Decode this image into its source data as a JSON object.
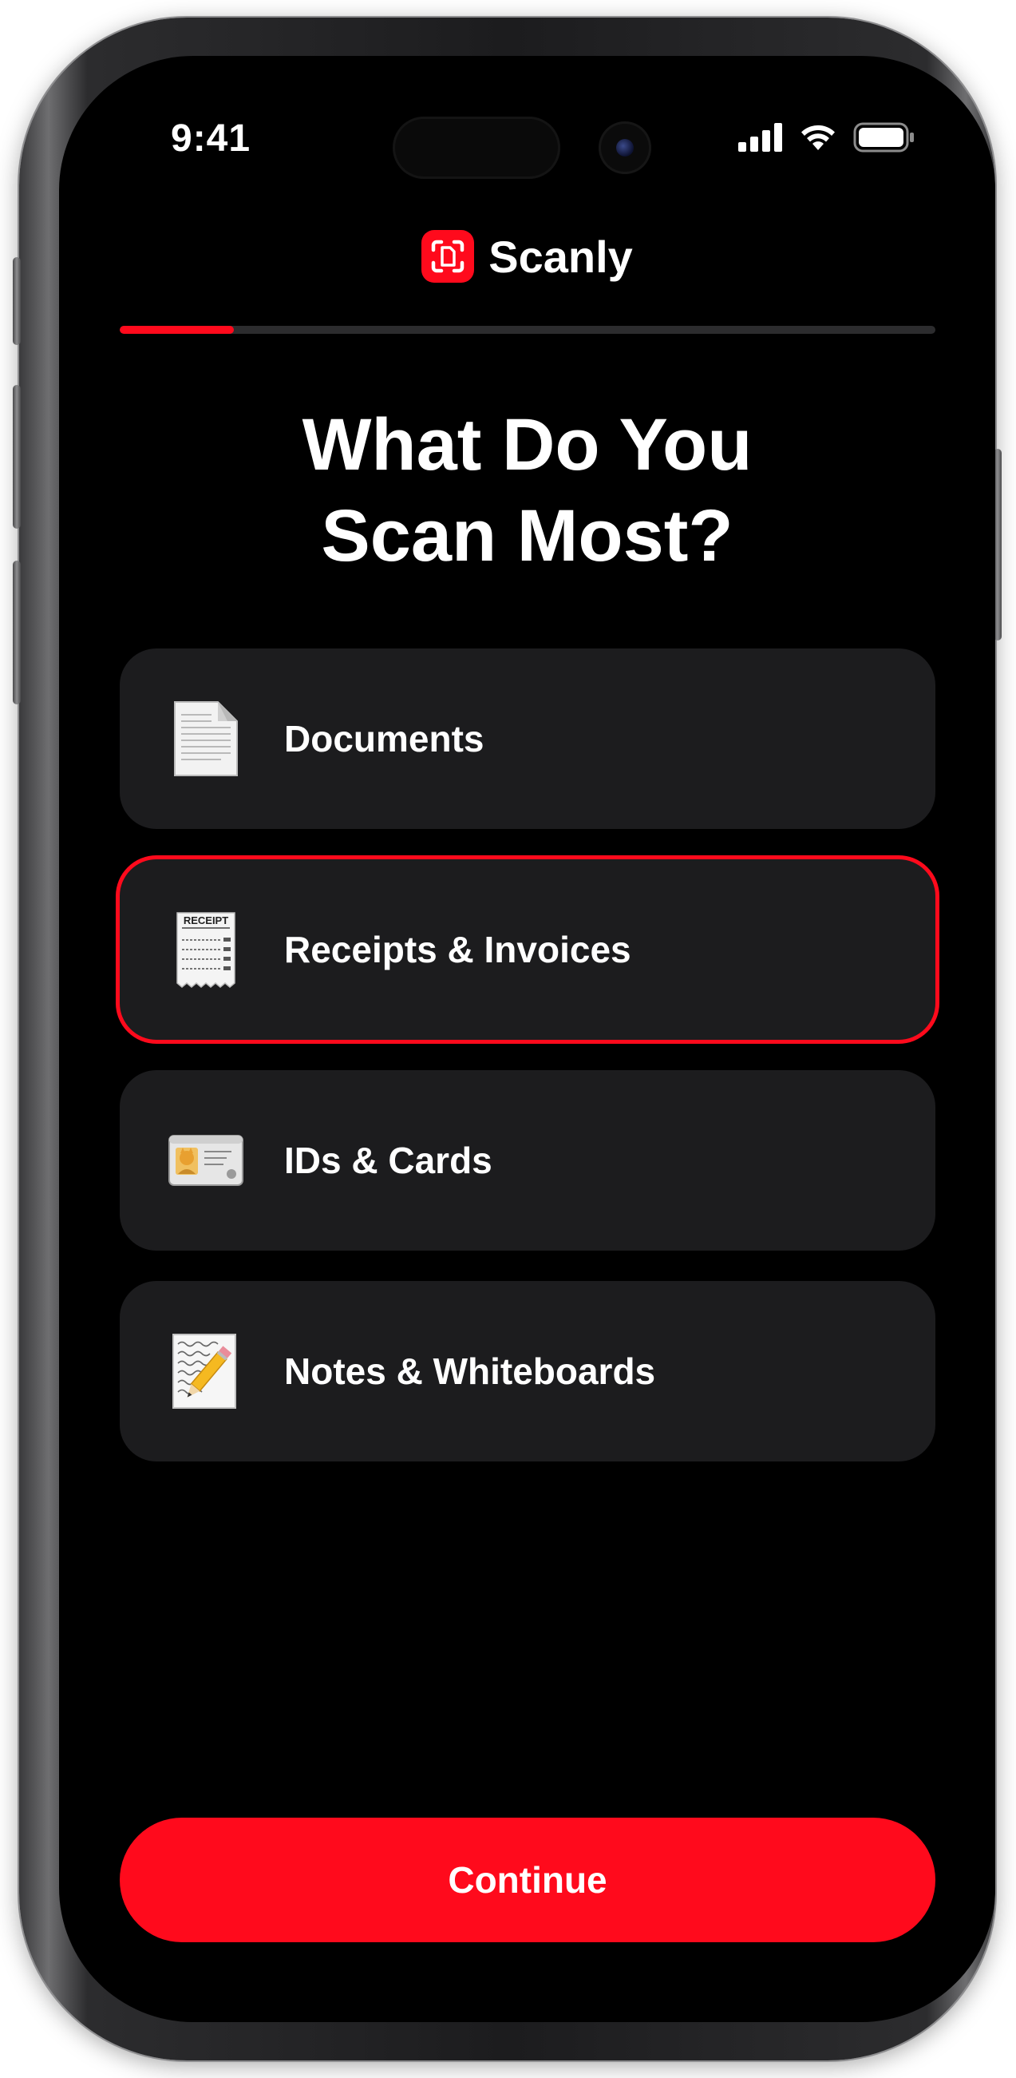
{
  "status_bar": {
    "time": "9:41",
    "icons": [
      "cellular-signal-icon",
      "wifi-icon",
      "battery-icon"
    ]
  },
  "brand": {
    "logo_icon": "scan-frame-icon",
    "name": "Scanly"
  },
  "onboarding_progress": 0.14,
  "question": {
    "line1": "What Do You",
    "line2": "Scan Most?"
  },
  "options": [
    {
      "label": "Documents",
      "icon": "document-icon",
      "selected": false
    },
    {
      "label": "Receipts & Invoices",
      "icon": "receipt-icon",
      "icon_text": "RECEIPT",
      "selected": true
    },
    {
      "label": "IDs & Cards",
      "icon": "id-card-icon",
      "selected": false
    },
    {
      "label": "Notes & Whiteboards",
      "icon": "note-pencil-icon",
      "selected": false
    }
  ],
  "continue_label": "Continue",
  "colors": {
    "accent": "#ff0a1c",
    "background": "#000000",
    "card": "#1c1c1e",
    "text": "#ffffff",
    "track": "#2c2c2e"
  }
}
